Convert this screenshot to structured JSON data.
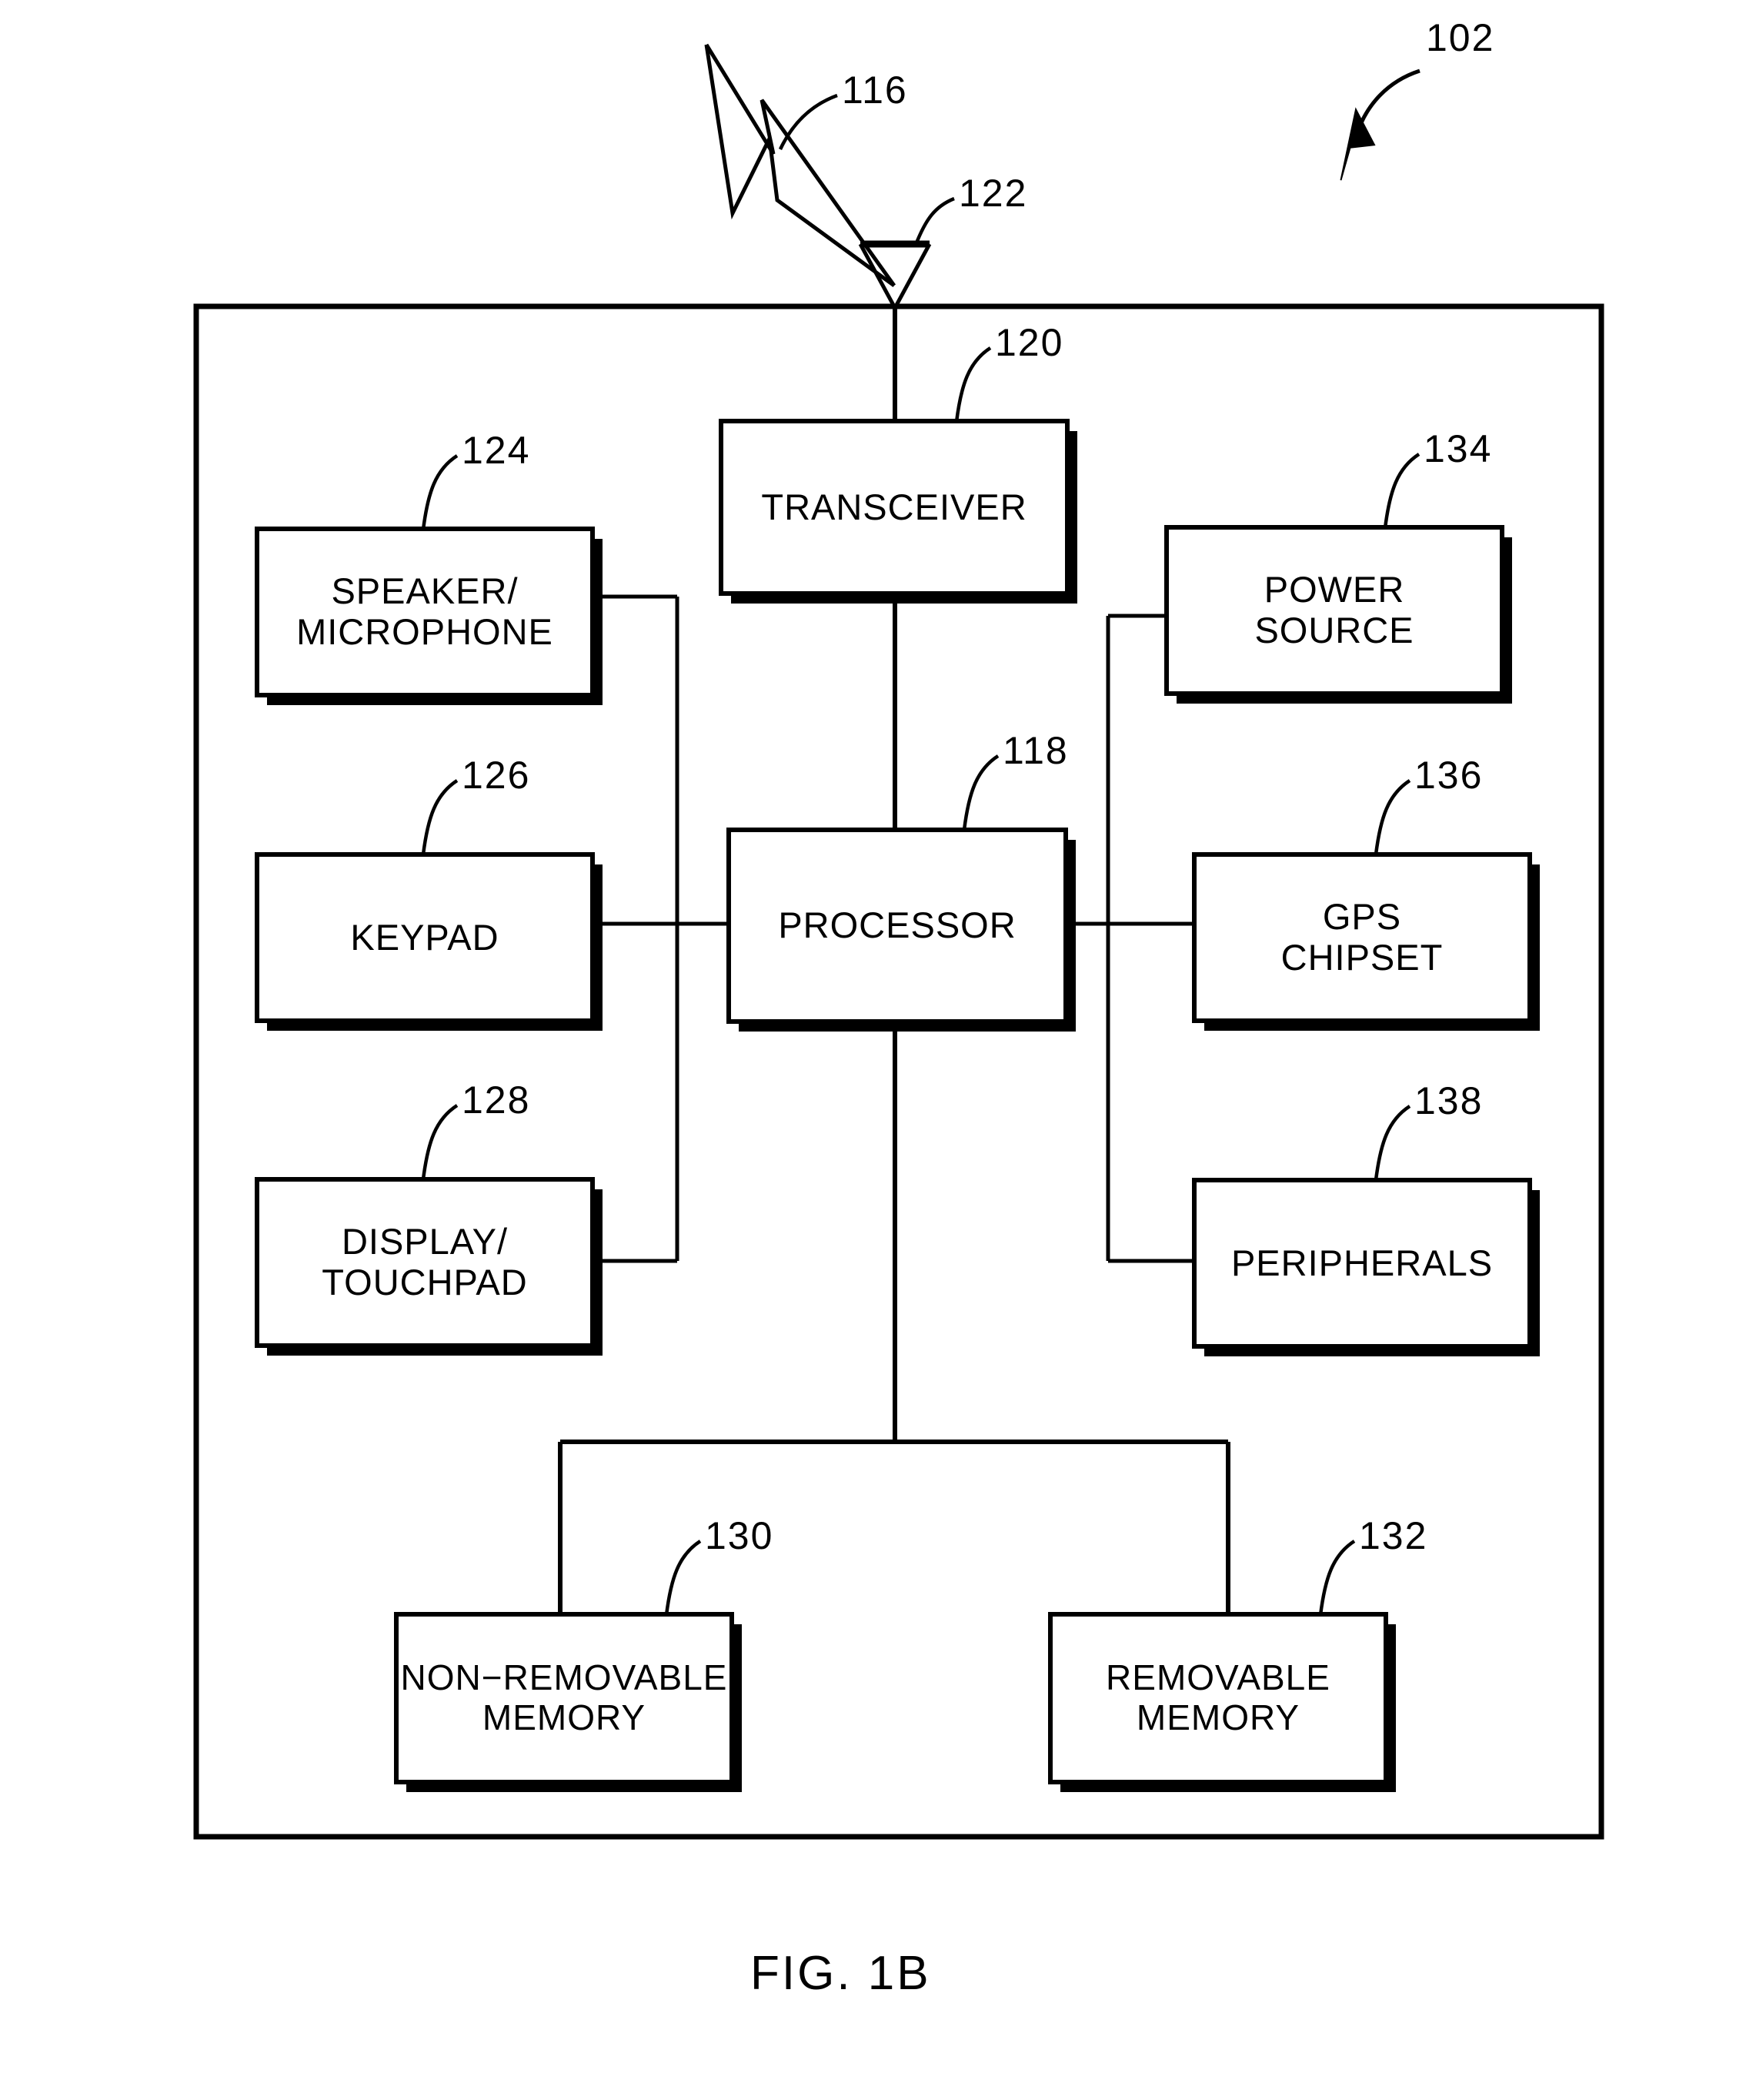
{
  "figure": {
    "caption": "FIG. 1B",
    "device_reference": "102"
  },
  "antenna": {
    "signal_label": "116",
    "antenna_label": "122"
  },
  "blocks": [
    {
      "id": "transceiver",
      "label": "TRANSCEIVER",
      "ref": "120"
    },
    {
      "id": "processor",
      "label": "PROCESSOR",
      "ref": "118"
    },
    {
      "id": "speaker_mic",
      "label": "SPEAKER/\nMICROPHONE",
      "ref": "124"
    },
    {
      "id": "keypad",
      "label": "KEYPAD",
      "ref": "126"
    },
    {
      "id": "display_touchpad",
      "label": "DISPLAY/\nTOUCHPAD",
      "ref": "128"
    },
    {
      "id": "power_source",
      "label": "POWER\nSOURCE",
      "ref": "134"
    },
    {
      "id": "gps_chipset",
      "label": "GPS\nCHIPSET",
      "ref": "136"
    },
    {
      "id": "peripherals",
      "label": "PERIPHERALS",
      "ref": "138"
    },
    {
      "id": "non_removable_memory",
      "label": "NON−REMOVABLE\nMEMORY",
      "ref": "130"
    },
    {
      "id": "removable_memory",
      "label": "REMOVABLE\nMEMORY",
      "ref": "132"
    }
  ],
  "colors": {
    "line": "#000000",
    "fill": "#ffffff",
    "shadow": "#000000",
    "background": "#ffffff"
  }
}
